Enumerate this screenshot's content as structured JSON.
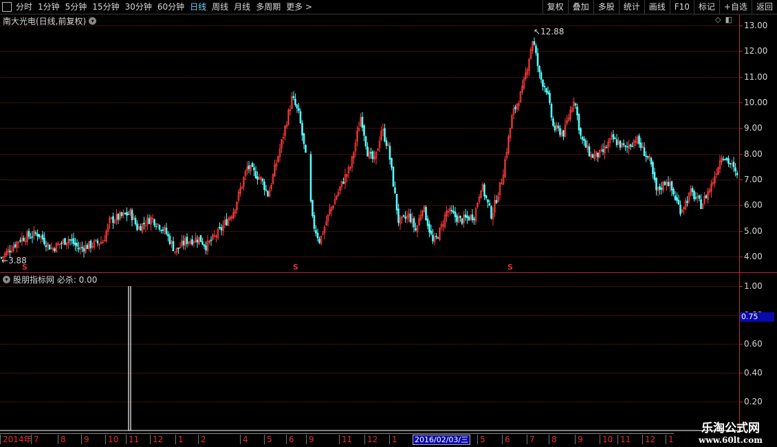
{
  "toolbar": {
    "periods": [
      "分时",
      "1分钟",
      "5分钟",
      "15分钟",
      "30分钟",
      "60分钟",
      "日线",
      "周线",
      "月线",
      "多周期",
      "更多 >"
    ],
    "active_period": "日线",
    "buttons": [
      "复权",
      "叠加",
      "多股",
      "统计",
      "画线",
      "F10",
      "标记",
      "+自选",
      "返回"
    ]
  },
  "main_chart": {
    "stock_title": "南大光电(日线,前复权)",
    "high_label": "12.88",
    "low_label": "3.88",
    "signal_glyph": "S",
    "y_ticks": [
      "13.00",
      "12.00",
      "11.00",
      "10.00",
      "9.00",
      "8.00",
      "7.00",
      "6.00",
      "5.00",
      "4.00"
    ]
  },
  "indicator": {
    "title": "股朋指标网 必杀: 0.00",
    "y_ticks": [
      "1.00",
      "0.80",
      "0.60",
      "0.40",
      "0.20"
    ],
    "highlight_value": "0.75"
  },
  "date_axis": {
    "labels": [
      "2014年",
      "7",
      "8",
      "9",
      "10",
      "11",
      "12",
      "1",
      "2",
      "4",
      "5",
      "6",
      "9",
      "11",
      "12",
      "1",
      "5",
      "6",
      "7",
      "8",
      "9",
      "10",
      "11",
      "12",
      "1"
    ],
    "highlight": "2016/02/03/三"
  },
  "watermark": {
    "line1": "乐淘公式网",
    "line2": "www.60lt.com"
  },
  "colors": {
    "up": "#ff3b3b",
    "down": "#54ffff",
    "grid": "#7a1a1a",
    "axis": "#c0262c"
  },
  "chart_data": {
    "type": "candlestick",
    "price_path": [
      [
        0,
        3.9
      ],
      [
        30,
        4.7
      ],
      [
        55,
        4.9
      ],
      [
        75,
        4.3
      ],
      [
        100,
        4.7
      ],
      [
        115,
        4.3
      ],
      [
        150,
        4.6
      ],
      [
        160,
        5.4
      ],
      [
        190,
        5.7
      ],
      [
        200,
        5.1
      ],
      [
        220,
        5.5
      ],
      [
        240,
        5.0
      ],
      [
        255,
        4.2
      ],
      [
        270,
        4.6
      ],
      [
        290,
        4.7
      ],
      [
        300,
        4.4
      ],
      [
        320,
        5.0
      ],
      [
        340,
        5.8
      ],
      [
        360,
        7.5
      ],
      [
        380,
        7.0
      ],
      [
        390,
        6.4
      ],
      [
        410,
        8.5
      ],
      [
        425,
        10.2
      ],
      [
        435,
        9.5
      ],
      [
        445,
        7.8
      ],
      [
        455,
        5.3
      ],
      [
        465,
        4.6
      ],
      [
        480,
        5.8
      ],
      [
        500,
        7.0
      ],
      [
        510,
        7.5
      ],
      [
        525,
        9.5
      ],
      [
        535,
        8.0
      ],
      [
        545,
        7.7
      ],
      [
        555,
        9.0
      ],
      [
        565,
        8.2
      ],
      [
        580,
        5.3
      ],
      [
        595,
        5.6
      ],
      [
        605,
        5.0
      ],
      [
        615,
        6.0
      ],
      [
        630,
        4.5
      ],
      [
        640,
        5.0
      ],
      [
        650,
        5.8
      ],
      [
        670,
        5.4
      ],
      [
        690,
        5.6
      ],
      [
        700,
        6.8
      ],
      [
        715,
        5.6
      ],
      [
        730,
        7.0
      ],
      [
        745,
        9.5
      ],
      [
        760,
        10.5
      ],
      [
        775,
        12.5
      ],
      [
        785,
        11.0
      ],
      [
        795,
        10.5
      ],
      [
        805,
        9.0
      ],
      [
        820,
        8.8
      ],
      [
        835,
        10.2
      ],
      [
        845,
        8.6
      ],
      [
        860,
        7.9
      ],
      [
        875,
        8.0
      ],
      [
        890,
        8.6
      ],
      [
        910,
        8.2
      ],
      [
        925,
        8.6
      ],
      [
        945,
        7.7
      ],
      [
        955,
        6.5
      ],
      [
        970,
        7.0
      ],
      [
        990,
        5.8
      ],
      [
        1005,
        6.5
      ],
      [
        1020,
        6.0
      ],
      [
        1035,
        6.8
      ],
      [
        1050,
        8.0
      ],
      [
        1065,
        7.5
      ],
      [
        1075,
        6.9
      ]
    ],
    "high": 12.88,
    "low": 3.88,
    "signal_date_index": 188,
    "indicator_series": {
      "name": "必杀",
      "value_range": [
        0,
        1
      ],
      "spike_value": 1.0
    }
  }
}
